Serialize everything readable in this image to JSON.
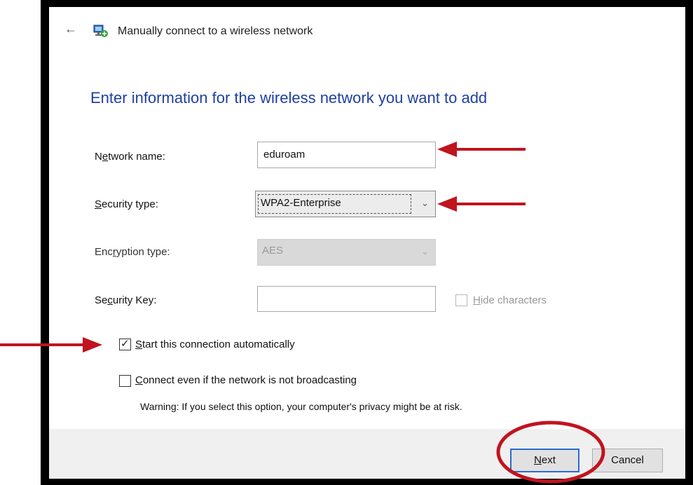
{
  "window": {
    "title": "Manually connect to a wireless network",
    "back_icon": "back-arrow-icon",
    "network_icon": "wireless-network-icon"
  },
  "heading": "Enter information for the wireless network you want to add",
  "fields": {
    "network_name": {
      "label_pre": "N",
      "label_accel": "e",
      "label_post": "twork name:",
      "value": "eduroam"
    },
    "security_type": {
      "label_pre": "",
      "label_accel": "S",
      "label_post": "ecurity type:",
      "value": "WPA2-Enterprise"
    },
    "encryption_type": {
      "label_pre": "Enc",
      "label_accel": "r",
      "label_post": "yption type:",
      "value": "AES"
    },
    "security_key": {
      "label_pre": "Se",
      "label_accel": "c",
      "label_post": "urity Key:",
      "value": ""
    }
  },
  "hide_characters": {
    "label_accel": "H",
    "label_post": "ide characters",
    "checked": false
  },
  "start_auto": {
    "label_pre": "",
    "label_accel": "S",
    "label_post": "tart this connection automatically",
    "checked": true
  },
  "connect_even": {
    "label_pre": "",
    "label_accel": "C",
    "label_post": "onnect even if the network is not broadcasting",
    "checked": false
  },
  "warning": "Warning: If you select this option, your computer's privacy might be at risk.",
  "buttons": {
    "next": {
      "accel": "N",
      "post": "ext"
    },
    "cancel": "Cancel"
  },
  "colors": {
    "heading": "#1f3fa3",
    "annotation": "#c0141f",
    "primary_border": "#2c6ad0"
  }
}
